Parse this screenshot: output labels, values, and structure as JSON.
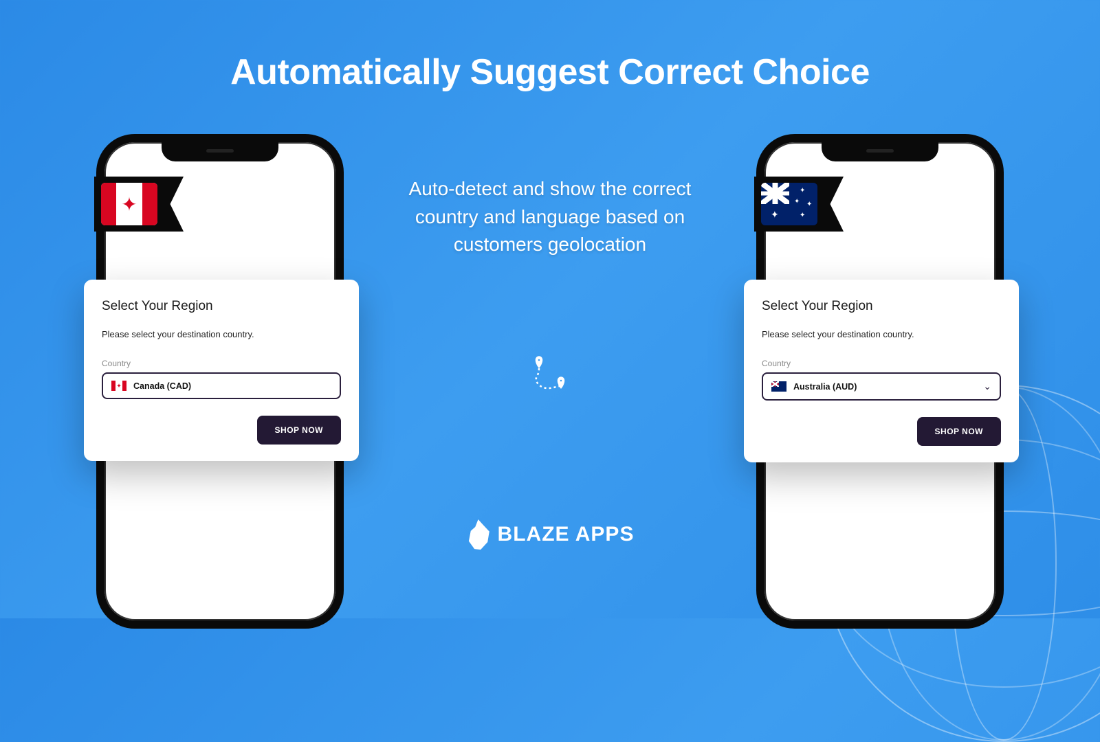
{
  "headline": "Automatically Suggest Correct Choice",
  "subtext": "Auto-detect and show the correct country and language based on customers geolocation",
  "brand": "BLAZE APPS",
  "card": {
    "title": "Select Your Region",
    "desc": "Please select your destination country.",
    "field_label": "Country",
    "shop_btn": "SHOP NOW"
  },
  "left_card": {
    "value": "Canada (CAD)"
  },
  "right_card": {
    "value": "Australia (AUD)"
  }
}
